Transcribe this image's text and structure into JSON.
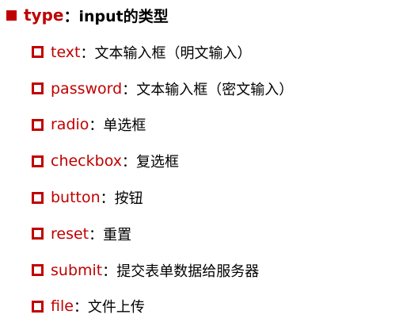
{
  "heading": {
    "keyword": "type",
    "description": "：input的类型"
  },
  "items": [
    {
      "keyword": "text",
      "description": "：文本输入框（明文输入）"
    },
    {
      "keyword": "password",
      "description": "：文本输入框（密文输入）"
    },
    {
      "keyword": "radio",
      "description": "：单选框"
    },
    {
      "keyword": "checkbox",
      "description": "：复选框"
    },
    {
      "keyword": "button",
      "description": "：按钮"
    },
    {
      "keyword": "reset",
      "description": "：重置"
    },
    {
      "keyword": "submit",
      "description": "：提交表单数据给服务器"
    },
    {
      "keyword": "file",
      "description": "：文件上传"
    }
  ],
  "colors": {
    "accent": "#c00000",
    "text": "#000000",
    "background": "#ffffff"
  },
  "icons": {
    "heading_bullet": "filled-square-icon",
    "item_bullet": "hollow-square-icon"
  }
}
